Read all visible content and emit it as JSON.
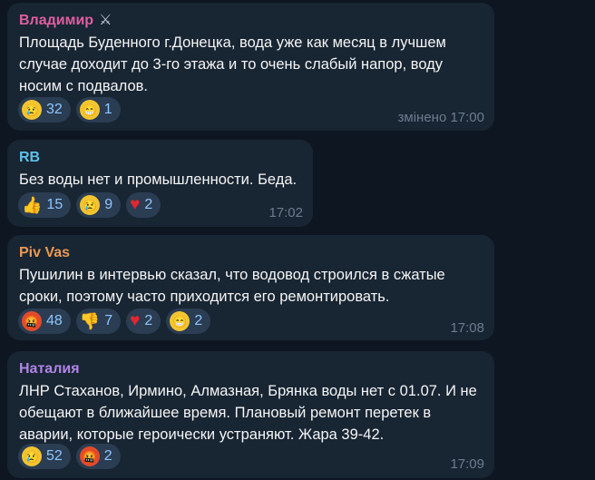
{
  "messages": [
    {
      "sender": "Владимир",
      "sender_color": "#e05ea0",
      "badge_icon": "crossed-swords-icon",
      "text": "Площадь Буденного г.Донецка, вода уже как месяц в лучшем случае доходит до 3-го этажа и то очень слабый напор, воду носим с подвалов.",
      "time": "змінено 17:00",
      "reactions": [
        {
          "icon": "crying-face-icon",
          "count": "32"
        },
        {
          "icon": "grinning-face-icon",
          "count": "1"
        }
      ]
    },
    {
      "sender": "RB",
      "sender_color": "#5cc3e8",
      "text": "Без воды нет и промышленности. Беда.",
      "time": "17:02",
      "reactions": [
        {
          "icon": "thumbs-up-icon",
          "count": "15"
        },
        {
          "icon": "crying-face-icon",
          "count": "9"
        },
        {
          "icon": "red-heart-icon",
          "count": "2"
        }
      ]
    },
    {
      "sender": "Piv Vas",
      "sender_color": "#eb9a4f",
      "text": "Пушилин в интервью сказал, что водовод строился в сжатые сроки, поэтому часто приходится его ремонтировать.",
      "time": "17:08",
      "reactions": [
        {
          "icon": "swearing-face-icon",
          "count": "48"
        },
        {
          "icon": "thumbs-down-icon",
          "count": "7"
        },
        {
          "icon": "red-heart-icon",
          "count": "2"
        },
        {
          "icon": "grinning-face-icon",
          "count": "2"
        }
      ]
    },
    {
      "sender": "Наталия",
      "sender_color": "#b185e6",
      "text": "ЛНР Стаханов, Ирмино, Алмазная, Брянка воды нет с 01.07. И не обещают в ближайшее время. Плановый ремонт перетек в аварии, которые героически устраняют. Жара 39-42.",
      "time": "17:09",
      "reactions": [
        {
          "icon": "crying-face-icon",
          "count": "52"
        },
        {
          "icon": "swearing-face-icon",
          "count": "2"
        }
      ]
    }
  ]
}
